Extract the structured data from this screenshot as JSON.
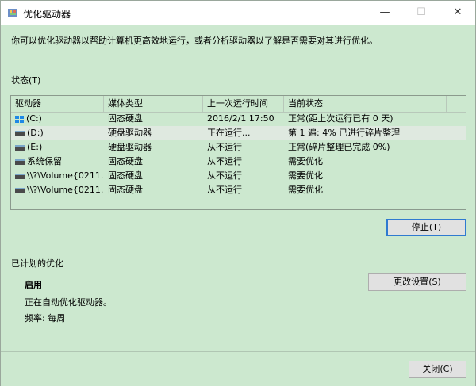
{
  "window": {
    "title": "优化驱动器"
  },
  "titlebar": {
    "minimize": "—",
    "maximize": "☐",
    "close": "✕"
  },
  "description": "你可以优化驱动器以帮助计算机更高效地运行，或者分析驱动器以了解是否需要对其进行优化。",
  "status_label": "状态(T)",
  "table": {
    "headers": [
      "驱动器",
      "媒体类型",
      "上一次运行时间",
      "当前状态"
    ],
    "rows": [
      {
        "drive": "(C:)",
        "media": "固态硬盘",
        "last_run": "2016/2/1 17:50",
        "status": "正常(距上次运行已有 0 天)",
        "icon": "windows-drive-icon"
      },
      {
        "drive": "(D:)",
        "media": "硬盘驱动器",
        "last_run": "正在运行...",
        "status": "第 1 遍: 4% 已进行碎片整理",
        "icon": "drive-icon"
      },
      {
        "drive": "(E:)",
        "media": "硬盘驱动器",
        "last_run": "从不运行",
        "status": "正常(碎片整理已完成 0%)",
        "icon": "drive-icon"
      },
      {
        "drive": "系统保留",
        "media": "固态硬盘",
        "last_run": "从不运行",
        "status": "需要优化",
        "icon": "drive-icon"
      },
      {
        "drive": "\\\\?\\Volume{0211...",
        "media": "固态硬盘",
        "last_run": "从不运行",
        "status": "需要优化",
        "icon": "drive-icon"
      },
      {
        "drive": "\\\\?\\Volume{0211...",
        "media": "固态硬盘",
        "last_run": "从不运行",
        "status": "需要优化",
        "icon": "drive-icon"
      }
    ]
  },
  "buttons": {
    "stop": "停止(T)",
    "change_settings": "更改设置(S)",
    "close": "关闭(C)"
  },
  "scheduled": {
    "label": "已计划的优化",
    "status": "启用",
    "description": "正在自动优化驱动器。",
    "frequency": "频率: 每周"
  }
}
